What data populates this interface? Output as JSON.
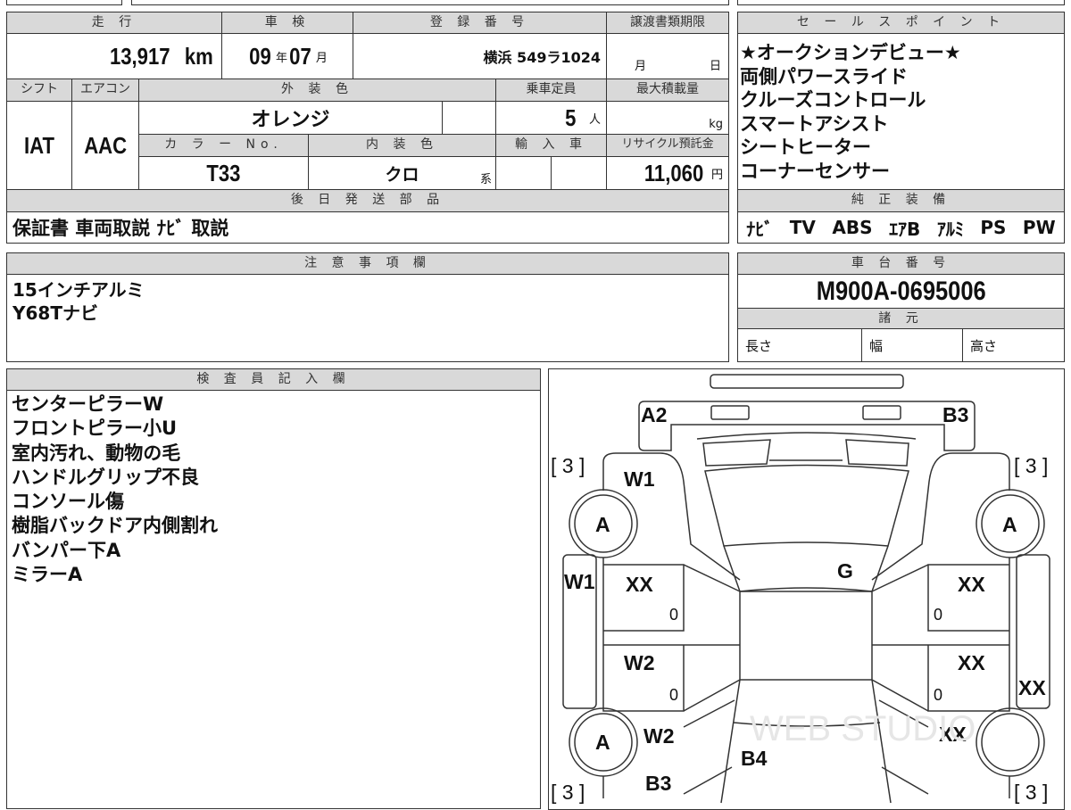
{
  "headers": {
    "mileage": "走 行",
    "inspection": "車 検",
    "registration": "登 録 番 号",
    "transfer_deadline": "譲渡書類期限",
    "shift": "シフト",
    "aircon": "エアコン",
    "exterior_color": "外 装 色",
    "capacity": "乗車定員",
    "max_load": "最大積載量",
    "color_no": "カ ラ ー No.",
    "interior_color": "内 装 色",
    "import": "輸 入 車",
    "recycle": "リサイクル預託金",
    "later_parts": "後 日 発 送 部 品",
    "sales_points": "セ ー ル ス ポ イ ン ト",
    "equipment": "純 正 装 備",
    "notes": "注 意 事 項 欄",
    "chassis": "車 台 番 号",
    "specs": "諸 元",
    "inspector": "検 査 員 記 入 欄"
  },
  "values": {
    "mileage": "13,917",
    "mileage_unit": "km",
    "insp_year": "09",
    "year_unit": "年",
    "insp_month": "07",
    "month_unit": "月",
    "registration": "横浜 549ラ1024",
    "deadline_month": "月",
    "deadline_day": "日",
    "shift": "IAT",
    "aircon": "AAC",
    "exterior_color": "オレンジ",
    "capacity": "5",
    "capacity_unit": "人",
    "load_unit": "kg",
    "color_no": "T33",
    "interior_color": "クロ",
    "interior_suffix": "系",
    "recycle": "11,060",
    "recycle_unit": "円",
    "later_parts": "保証書 車両取説 ﾅﾋﾞ 取説",
    "chassis": "M900A-0695006",
    "length": "長さ",
    "width": "幅",
    "height": "高さ"
  },
  "sales_points": [
    "★オークションデビュー★",
    "両側パワースライド",
    "クルーズコントロール",
    "スマートアシスト",
    "シートヒーター",
    "コーナーセンサー"
  ],
  "equipment": [
    "ﾅﾋﾞ",
    "TV",
    "ABS",
    "ｴｱB",
    "ｱﾙﾐ",
    "PS",
    "PW"
  ],
  "notes": [
    "15インチアルミ",
    "Y68Tナビ"
  ],
  "inspector_notes": [
    "センターピラーW",
    "フロントピラー小U",
    "室内汚れ、動物の毛",
    "ハンドルグリップ不良",
    "コンソール傷",
    "樹脂バックドア内側割れ",
    "バンパー下A",
    "ミラーA"
  ],
  "diagram": {
    "labels": [
      "A2",
      "B3",
      "[ 3 ]",
      "[ 3 ]",
      "W1",
      "A",
      "A",
      "W1",
      "XX",
      "G",
      "XX",
      "0",
      "0",
      "W2",
      "XX",
      "XX",
      "0",
      "0",
      "A",
      "W2",
      "B4",
      "XX",
      "B3",
      "[ 3 ]",
      "[ 3 ]"
    ],
    "watermark": "WEB STUDIO"
  }
}
